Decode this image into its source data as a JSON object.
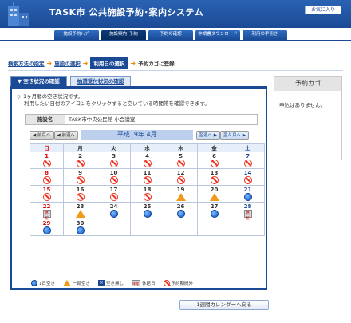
{
  "header": {
    "title": "TASK市 公共施設予約･案内システム",
    "fav_label": "お気に入り",
    "nav": [
      {
        "label": "施設予約ﾄｯﾌﾟ",
        "active": false
      },
      {
        "label": "施設案内･予約",
        "active": true
      },
      {
        "label": "予約の確認",
        "active": false
      },
      {
        "label": "申請書ダウンロード",
        "active": false
      },
      {
        "label": "利用の手引き",
        "active": false
      }
    ]
  },
  "breadcrumb": {
    "step1": "検索方法の指定",
    "step2": "施設の選択",
    "step3": "利用日の選択",
    "step4": "予約カゴに登録"
  },
  "tabs": {
    "vacancy": "空き状況の確認",
    "lottery": "抽選受付状況の確認"
  },
  "info": {
    "line1": "1ヶ月間の空き状況です。",
    "line2": "利用したい日付のアイコンをクリックすると空いている時間帯を確認できます。"
  },
  "facility": {
    "label": "施設名",
    "value": "TASK市中央公民館 小会議室"
  },
  "month_nav": {
    "prev_month": "前月へ",
    "prev_week": "前週へ",
    "current": "平成19年 4月",
    "next_week": "翌週へ",
    "next_month": "翌々月へ"
  },
  "weekdays": [
    "日",
    "月",
    "火",
    "水",
    "木",
    "金",
    "土"
  ],
  "calendar": [
    [
      {
        "d": "1",
        "s": "no"
      },
      {
        "d": "2",
        "s": "no"
      },
      {
        "d": "3",
        "s": "no"
      },
      {
        "d": "4",
        "s": "no"
      },
      {
        "d": "5",
        "s": "no"
      },
      {
        "d": "6",
        "s": "no"
      },
      {
        "d": "7",
        "s": "no"
      }
    ],
    [
      {
        "d": "8",
        "s": "no"
      },
      {
        "d": "9",
        "s": "no"
      },
      {
        "d": "10",
        "s": "no"
      },
      {
        "d": "11",
        "s": "no"
      },
      {
        "d": "12",
        "s": "no"
      },
      {
        "d": "13",
        "s": "no"
      },
      {
        "d": "14",
        "s": "no"
      }
    ],
    [
      {
        "d": "15",
        "s": "no"
      },
      {
        "d": "16",
        "s": "no"
      },
      {
        "d": "17",
        "s": "no"
      },
      {
        "d": "18",
        "s": "no"
      },
      {
        "d": "19",
        "s": "some"
      },
      {
        "d": "20",
        "s": "some"
      },
      {
        "d": "21",
        "s": "ok"
      }
    ],
    [
      {
        "d": "22",
        "s": "hol"
      },
      {
        "d": "23",
        "s": "some"
      },
      {
        "d": "24",
        "s": "ok"
      },
      {
        "d": "25",
        "s": "ok"
      },
      {
        "d": "26",
        "s": "ok"
      },
      {
        "d": "27",
        "s": "ok"
      },
      {
        "d": "28",
        "s": "hol"
      }
    ],
    [
      {
        "d": "29",
        "s": "ok"
      },
      {
        "d": "30",
        "s": "ok"
      },
      {
        "d": "",
        "s": ""
      },
      {
        "d": "",
        "s": ""
      },
      {
        "d": "",
        "s": ""
      },
      {
        "d": "",
        "s": ""
      },
      {
        "d": "",
        "s": ""
      }
    ]
  ],
  "holiday_text": "休館",
  "legend": {
    "ok": "1日空き",
    "some": "一部空き",
    "full": "空き無し",
    "holiday": "休館日",
    "out": "予約期間外"
  },
  "week_button": "1週間カレンダーへ戻る",
  "cart": {
    "title": "予約カゴ",
    "empty": "申込はありません。"
  }
}
